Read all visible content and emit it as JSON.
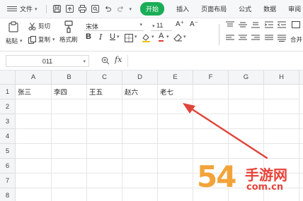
{
  "menubar": {
    "file_label": "文件",
    "start_label": "开始",
    "tabs": [
      "插入",
      "页面布局",
      "公式",
      "数据",
      "审阅"
    ]
  },
  "ribbon": {
    "paste_label": "粘贴",
    "cut_label": "剪切",
    "copy_label": "复制",
    "format_painter_label": "格式刷",
    "font_name": "宋体",
    "font_size": "11",
    "merge_label": "合并"
  },
  "formula_bar": {
    "name_box": "011",
    "fx_label": "fx",
    "formula_value": ""
  },
  "sheet": {
    "columns": [
      "A",
      "B",
      "C",
      "D",
      "E",
      "F",
      "G",
      "H"
    ],
    "rows": [
      "1",
      "2",
      "3",
      "4",
      "5",
      "6",
      "7",
      "8"
    ],
    "row1_values": [
      "张三",
      "李四",
      "王五",
      "赵六",
      "老七",
      "",
      "",
      ""
    ]
  },
  "annotation": {
    "arrow_color": "#e0443a"
  },
  "watermark": {
    "number": "54",
    "site_name": "手游网",
    "url": "com.cn"
  },
  "colors": {
    "accent_green": "#1aad56",
    "header_bg": "#f4f5f7"
  }
}
